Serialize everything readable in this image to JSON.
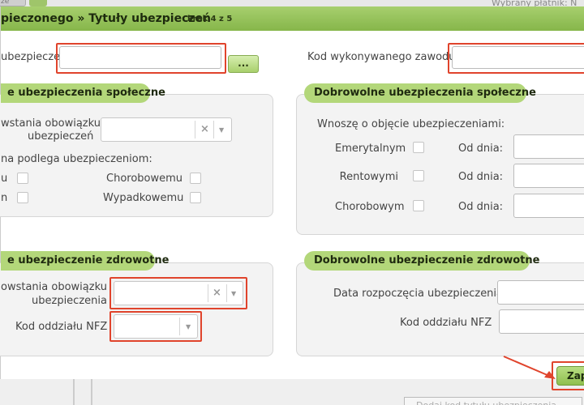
{
  "background": {
    "top_tab": "ze",
    "top_right_text": "Wybrany płatnik: N",
    "bottom_button": "Dodaj kod tytułu ubezpieczenia"
  },
  "dialog": {
    "title": "pieczonego » Tytuły ubezpieczeń",
    "step": "krok 4 z 5",
    "kod_tytulu_label": "ubezpieczenia:",
    "kod_tytulu_value": "",
    "browse_label": "...",
    "kod_zawodu_label": "Kod wykonywanego zawodu:",
    "kod_zawodu_value": ""
  },
  "panel_spoleczne": {
    "title": "e ubezpieczenia społeczne",
    "date_label_1": "wstania obowiązku",
    "date_label_2": "ubezpieczeń",
    "clear_icon": "×",
    "subtitle": "na podlega ubezpieczeniom:",
    "row1_left": "u",
    "row1_right": "Chorobowemu",
    "row2_left": "n",
    "row2_right": "Wypadkowemu"
  },
  "panel_dobrowolne_spoleczne": {
    "title": "Dobrowolne ubezpieczenia społeczne",
    "subtitle": "Wnoszę o objęcie ubezpieczeniami:",
    "rows": [
      {
        "label": "Emerytalnym",
        "od_dnia": "Od dnia:"
      },
      {
        "label": "Rentowymi",
        "od_dnia": "Od dnia:"
      },
      {
        "label": "Chorobowym",
        "od_dnia": "Od dnia:"
      }
    ]
  },
  "panel_zdrowotne": {
    "title": "e ubezpieczenie zdrowotne",
    "date_label_1": "owstania obowiązku",
    "date_label_2": "ubezpieczenia",
    "clear_icon": "×",
    "nfz_label": "Kod oddziału NFZ"
  },
  "panel_dobrowolne_zdrowotne": {
    "title": "Dobrowolne ubezpieczenie zdrowotne",
    "date_label": "Data rozpoczęcia ubezpieczenia",
    "nfz_label": "Kod oddziału NFZ"
  },
  "footer": {
    "save_label": "Zapi"
  },
  "colors": {
    "accent_green": "#9cc95e",
    "highlight_red": "#e0442c"
  }
}
